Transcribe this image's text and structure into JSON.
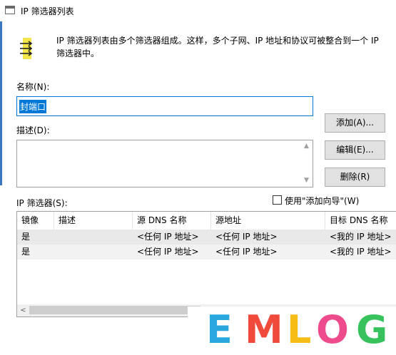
{
  "window": {
    "title": "IP 筛选器列表"
  },
  "header": {
    "description": "IP 筛选器列表由多个筛选器组成。这样，多个子网、IP 地址和协议可被整合到一个 IP 筛选器中。"
  },
  "name_field": {
    "label": "名称(N):",
    "value": "封端口"
  },
  "description_field": {
    "label": "描述(D):",
    "value": ""
  },
  "buttons": {
    "add": "添加(A)...",
    "edit": "编辑(E)...",
    "delete": "删除(R)"
  },
  "filters_label": "IP 筛选器(S):",
  "wizard_checkbox": {
    "label": "使用\"添加向导\"(W)",
    "checked": false
  },
  "table": {
    "columns": [
      "镜像",
      "描述",
      "源 DNS 名称",
      "源地址",
      "目标 DNS 名称"
    ],
    "rows": [
      {
        "mirror": "是",
        "description": "",
        "src_dns": "<任何 IP 地址>",
        "src_addr": "<任何 IP 地址>",
        "dst_dns": "<我的 IP 地址>"
      },
      {
        "mirror": "是",
        "description": "",
        "src_dns": "<任何 IP 地址>",
        "src_addr": "<任何 IP 地址>",
        "dst_dns": "<我的 IP 地址>"
      }
    ]
  },
  "watermark": {
    "letters": [
      "E",
      "M",
      "L",
      "O",
      "G"
    ],
    "colors": [
      "#29a8e0",
      "#f04a3c",
      "#f6bd16",
      "#ee4b8c",
      "#37c25e"
    ]
  },
  "icons": {
    "title": "window-icon",
    "header": "filter-list-icon"
  }
}
